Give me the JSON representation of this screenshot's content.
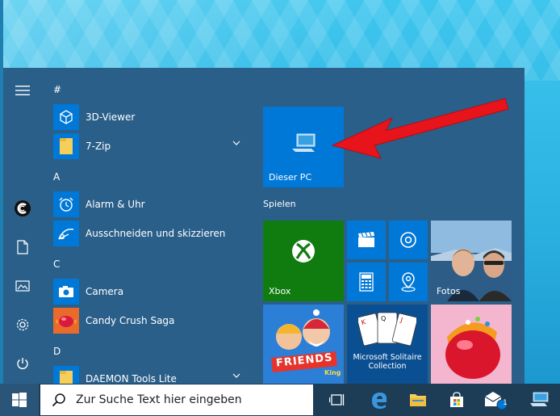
{
  "start_menu": {
    "app_list": {
      "sections": [
        {
          "letter": "#",
          "apps": [
            {
              "label": "3D-Viewer",
              "icon": "cube-icon"
            },
            {
              "label": "7-Zip",
              "icon": "folder-icon",
              "expandable": true
            }
          ]
        },
        {
          "letter": "A",
          "apps": [
            {
              "label": "Alarm & Uhr",
              "icon": "alarm-clock-icon"
            },
            {
              "label": "Ausschneiden und skizzieren",
              "icon": "snip-sketch-icon"
            }
          ]
        },
        {
          "letter": "C",
          "apps": [
            {
              "label": "Camera",
              "icon": "camera-icon"
            },
            {
              "label": "Candy Crush Saga",
              "icon": "candy-icon"
            }
          ]
        },
        {
          "letter": "D",
          "apps": [
            {
              "label": "DAEMON Tools Lite",
              "icon": "folder-icon",
              "expandable": true
            }
          ]
        }
      ]
    },
    "tiles": {
      "dieser_pc": "Dieser PC",
      "group_title": "Spielen",
      "xbox": "Xbox",
      "fotos": "Fotos",
      "solitaire": "Microsoft Solitaire Collection",
      "friends_logo": "FRIENDS",
      "friends_badge": "King"
    },
    "rail": [
      "hamburger-icon",
      "ccleaner-icon",
      "document-icon",
      "pictures-icon",
      "settings-icon",
      "power-icon"
    ]
  },
  "taskbar": {
    "search_placeholder": "Zur Suche Text hier eingeben",
    "mail_badge": "1"
  },
  "colors": {
    "accent": "#0078d7",
    "start_bg": "#2a5f8a",
    "xbox_green": "#107c10",
    "arrow_red": "#e8141c"
  }
}
